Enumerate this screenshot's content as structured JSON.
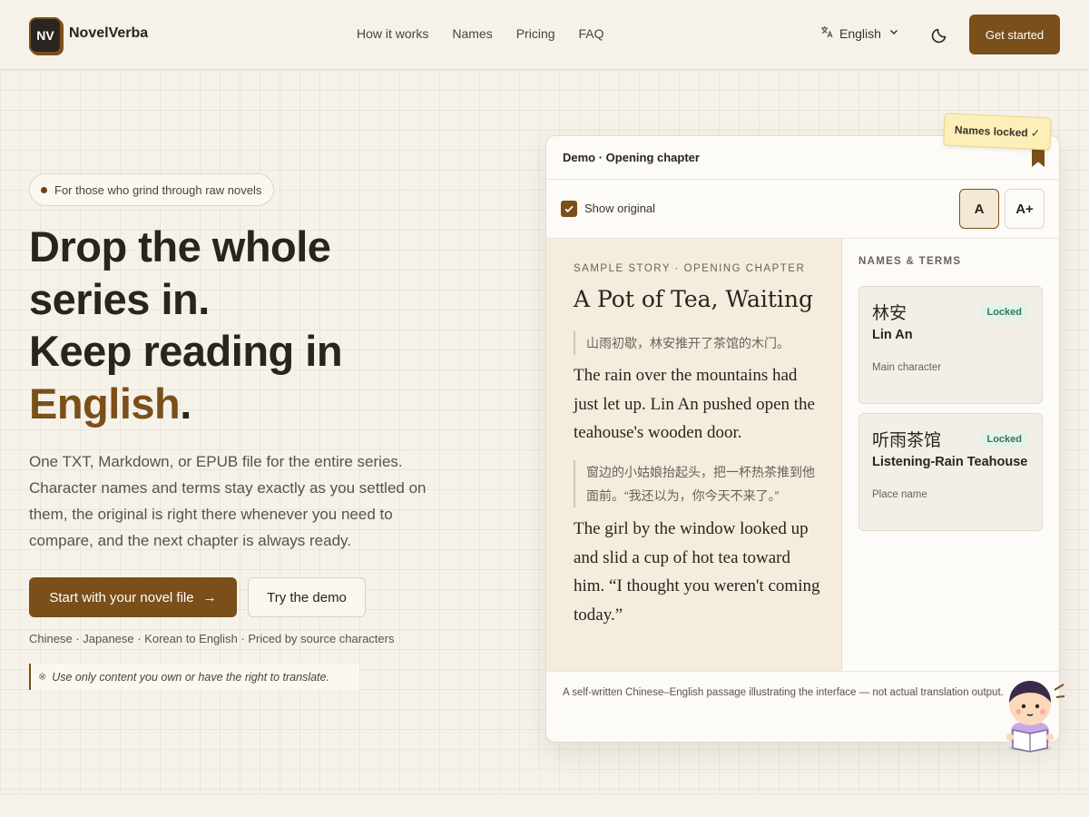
{
  "header": {
    "logo_mark": "NV",
    "brand": "NovelVerba",
    "nav": [
      "How it works",
      "Names",
      "Pricing",
      "FAQ"
    ],
    "language": "English",
    "cta": "Get started"
  },
  "hero": {
    "pill": "For those who grind through raw novels",
    "headline_1": "Drop the whole",
    "headline_2": "series in.",
    "headline_3": "Keep reading in",
    "headline_accent": "English",
    "headline_period": ".",
    "subtext": "One TXT, Markdown, or EPUB file for the entire series. Character names and terms stay exactly as you settled on them, the original is right there whenever you need to compare, and the next chapter is always ready.",
    "primary_button": "Start with your novel file",
    "primary_arrow": "→",
    "secondary_button": "Try the demo",
    "languages_note": "Chinese · Japanese · Korean to English · Priced by source characters",
    "legal_mark": "※",
    "legal_note": "Use only content you own or have the right to translate."
  },
  "demo": {
    "title": "Demo · Opening chapter",
    "sticky_note": "Names locked ✓",
    "show_original_label": "Show original",
    "font_small": "A",
    "font_large": "A+",
    "kicker": "SAMPLE STORY · OPENING CHAPTER",
    "story_title": "A Pot of Tea, Waiting",
    "original_1": "山雨初歇，林安推开了茶馆的木门。",
    "translation_1": "The rain over the mountains had just let up. Lin An pushed open the teahouse's wooden door.",
    "original_2": "窗边的小姑娘抬起头，把一杯热茶推到他面前。“我还以为，你今天不来了。”",
    "translation_2": "The girl by the window looked up and slid a cup of hot tea toward him. “I thought you weren't coming today.”",
    "terms_title": "NAMES & TERMS",
    "terms": [
      {
        "zh": "林安",
        "en": "Lin An",
        "type": "Main character",
        "status": "Locked"
      },
      {
        "zh": "听雨茶馆",
        "en": "Listening-Rain Teahouse",
        "type": "Place name",
        "status": "Locked"
      }
    ],
    "footer": "A self-written Chinese–English passage illustrating the interface — not actual translation output."
  },
  "colors": {
    "accent": "#7a4f1a",
    "background": "#f6f2ea",
    "locked_badge": "#2f7a50"
  }
}
